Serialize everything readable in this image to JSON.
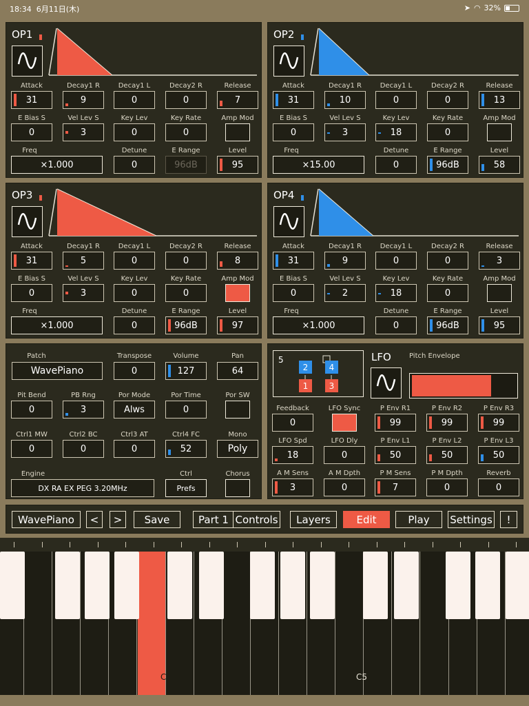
{
  "status": {
    "time": "18:34",
    "date": "6月11日(木)",
    "battery": "32%"
  },
  "colors": {
    "red": "#ee5a45",
    "blue": "#2f8fe8"
  },
  "ops": [
    {
      "title": "OP1",
      "color": "red",
      "row1": [
        {
          "label": "Attack",
          "value": "31"
        },
        {
          "label": "Decay1 R",
          "value": "9"
        },
        {
          "label": "Decay1 L",
          "value": "0"
        },
        {
          "label": "Decay2 R",
          "value": "0"
        },
        {
          "label": "Release",
          "value": "7"
        }
      ],
      "row2": [
        {
          "label": "E Bias S",
          "value": "0"
        },
        {
          "label": "Vel Lev S",
          "value": "3"
        },
        {
          "label": "Key Lev",
          "value": "0"
        },
        {
          "label": "Key Rate",
          "value": "0"
        },
        {
          "label": "Amp Mod",
          "value": ""
        }
      ],
      "row3": [
        {
          "label": "Freq",
          "value": "×1.000"
        },
        {
          "label": "Detune",
          "value": "0"
        },
        {
          "label": "E Range",
          "value": "96dB"
        },
        {
          "label": "Level",
          "value": "95"
        }
      ]
    },
    {
      "title": "OP2",
      "color": "blue",
      "row1": [
        {
          "label": "Attack",
          "value": "31"
        },
        {
          "label": "Decay1 R",
          "value": "10"
        },
        {
          "label": "Decay1 L",
          "value": "0"
        },
        {
          "label": "Decay2 R",
          "value": "0"
        },
        {
          "label": "Release",
          "value": "13"
        }
      ],
      "row2": [
        {
          "label": "E Bias S",
          "value": "0"
        },
        {
          "label": "Vel Lev S",
          "value": "3"
        },
        {
          "label": "Key Lev",
          "value": "18"
        },
        {
          "label": "Key Rate",
          "value": "0"
        },
        {
          "label": "Amp Mod",
          "value": ""
        }
      ],
      "row3": [
        {
          "label": "Freq",
          "value": "×15.00"
        },
        {
          "label": "Detune",
          "value": "0"
        },
        {
          "label": "E Range",
          "value": "96dB"
        },
        {
          "label": "Level",
          "value": "58"
        }
      ]
    },
    {
      "title": "OP3",
      "color": "red",
      "row1": [
        {
          "label": "Attack",
          "value": "31"
        },
        {
          "label": "Decay1 R",
          "value": "5"
        },
        {
          "label": "Decay1 L",
          "value": "0"
        },
        {
          "label": "Decay2 R",
          "value": "0"
        },
        {
          "label": "Release",
          "value": "8"
        }
      ],
      "row2": [
        {
          "label": "E Bias S",
          "value": "0"
        },
        {
          "label": "Vel Lev S",
          "value": "3"
        },
        {
          "label": "Key Lev",
          "value": "0"
        },
        {
          "label": "Key Rate",
          "value": "0"
        },
        {
          "label": "Amp Mod",
          "value": ""
        }
      ],
      "row3": [
        {
          "label": "Freq",
          "value": "×1.000"
        },
        {
          "label": "Detune",
          "value": "0"
        },
        {
          "label": "E Range",
          "value": "96dB"
        },
        {
          "label": "Level",
          "value": "97"
        }
      ]
    },
    {
      "title": "OP4",
      "color": "blue",
      "row1": [
        {
          "label": "Attack",
          "value": "31"
        },
        {
          "label": "Decay1 R",
          "value": "9"
        },
        {
          "label": "Decay1 L",
          "value": "0"
        },
        {
          "label": "Decay2 R",
          "value": "0"
        },
        {
          "label": "Release",
          "value": "3"
        }
      ],
      "row2": [
        {
          "label": "E Bias S",
          "value": "0"
        },
        {
          "label": "Vel Lev S",
          "value": "2"
        },
        {
          "label": "Key Lev",
          "value": "18"
        },
        {
          "label": "Key Rate",
          "value": "0"
        },
        {
          "label": "Amp Mod",
          "value": ""
        }
      ],
      "row3": [
        {
          "label": "Freq",
          "value": "×1.000"
        },
        {
          "label": "Detune",
          "value": "0"
        },
        {
          "label": "E Range",
          "value": "96dB"
        },
        {
          "label": "Level",
          "value": "95"
        }
      ]
    }
  ],
  "patch": {
    "patch_label": "Patch",
    "patch_value": "WavePiano",
    "transpose_label": "Transpose",
    "transpose": "0",
    "volume_label": "Volume",
    "volume": "127",
    "pan_label": "Pan",
    "pan": "64",
    "pitbend_label": "Pit Bend",
    "pitbend": "0",
    "pbrng_label": "PB Rng",
    "pbrng": "3",
    "pormode_label": "Por Mode",
    "pormode": "Alws",
    "portime_label": "Por Time",
    "portime": "0",
    "porsw_label": "Por SW",
    "porsw": "",
    "ctrl1_label": "Ctrl1 MW",
    "ctrl1": "0",
    "ctrl2_label": "Ctrl2 BC",
    "ctrl2": "0",
    "ctrl3_label": "Ctrl3 AT",
    "ctrl3": "0",
    "ctrl4_label": "Ctrl4 FC",
    "ctrl4": "52",
    "mono_label": "Mono",
    "mono": "Poly",
    "engine_label": "Engine",
    "engine": "DX RA EX PEG 3.20MHz",
    "ctrl_label": "Ctrl",
    "ctrl": "Prefs",
    "chorus_label": "Chorus",
    "chorus": ""
  },
  "lfo": {
    "algorithm": "5",
    "op_top1": "2",
    "op_top2": "4",
    "op_bot1": "1",
    "op_bot2": "3",
    "title": "LFO",
    "pitch_env_label": "Pitch Envelope",
    "feedback_label": "Feedback",
    "feedback": "0",
    "lfosync_label": "LFO Sync",
    "lfosync": "",
    "penvr1_label": "P Env R1",
    "penvr1": "99",
    "penvr2_label": "P Env R2",
    "penvr2": "99",
    "penvr3_label": "P Env R3",
    "penvr3": "99",
    "lfospd_label": "LFO Spd",
    "lfospd": "18",
    "lfodly_label": "LFO Dly",
    "lfodly": "0",
    "penvl1_label": "P Env L1",
    "penvl1": "50",
    "penvl2_label": "P Env L2",
    "penvl2": "50",
    "penvl3_label": "P Env L3",
    "penvl3": "50",
    "amsens_label": "A M Sens",
    "amsens": "3",
    "amdpth_label": "A M Dpth",
    "amdpth": "0",
    "pmsens_label": "P M Sens",
    "pmsens": "7",
    "pmdpth_label": "P M Dpth",
    "pmdpth": "0",
    "reverb_label": "Reverb",
    "reverb": "0"
  },
  "toolbar": {
    "patch": "WavePiano",
    "prev": "<",
    "next": ">",
    "save": "Save",
    "part": "Part 1",
    "controls": "Controls",
    "layers": "Layers",
    "edit": "Edit",
    "play": "Play",
    "settings": "Settings",
    "bang": "!"
  },
  "keyboard": {
    "c4": "C4",
    "c5": "C5"
  }
}
